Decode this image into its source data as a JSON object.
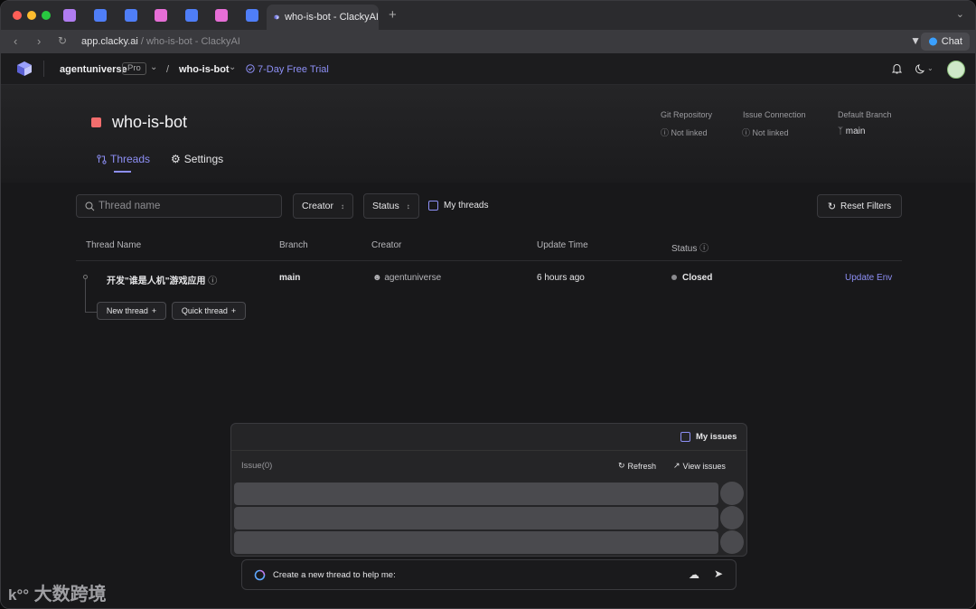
{
  "browser": {
    "active_tab_title": "who-is-bot - ClackyAI",
    "url_domain": "app.clacky.ai",
    "url_rest": " / who-is-bot - ClackyAI",
    "chat_label": "Chat",
    "tab_icon_colors": [
      "#b07cf0",
      "#4f7ef7",
      "#4f7ef7",
      "#e66ed6",
      "#4f7ef7",
      "#e66ed6",
      "#4f7ef7"
    ]
  },
  "header": {
    "org": "agentuniverse",
    "plan": "Pro",
    "separator": "/",
    "project": "who-is-bot",
    "trial": "7-Day Free Trial"
  },
  "project": {
    "title": "who-is-bot",
    "git_label": "Git Repository",
    "git_value": "Not linked",
    "issue_label": "Issue Connection",
    "issue_value": "Not linked",
    "branch_label": "Default Branch",
    "branch_value": "main"
  },
  "tabs": {
    "threads": "Threads",
    "settings": "Settings"
  },
  "filters": {
    "search_placeholder": "Thread name",
    "creator": "Creator",
    "status": "Status",
    "my_threads": "My threads",
    "reset": "Reset Filters"
  },
  "table": {
    "headers": [
      "Thread Name",
      "Branch",
      "Creator",
      "Update Time",
      "Status"
    ],
    "rows": [
      {
        "name": "开发\"谁是人机\"游戏应用",
        "branch": "main",
        "creator": "agentuniverse",
        "updated": "6 hours ago",
        "status": "Closed",
        "action": "Update Env"
      }
    ],
    "new_thread": "New thread",
    "quick_thread": "Quick thread"
  },
  "issues": {
    "my_issues": "My issues",
    "title": "Issue(0)",
    "refresh": "Refresh",
    "view": "View issues"
  },
  "prompt": {
    "text": "Create a new thread to help me:"
  },
  "watermark": "大数跨境",
  "colors": {
    "accent": "#8d8ff5",
    "project_icon": "#f26d6d"
  }
}
